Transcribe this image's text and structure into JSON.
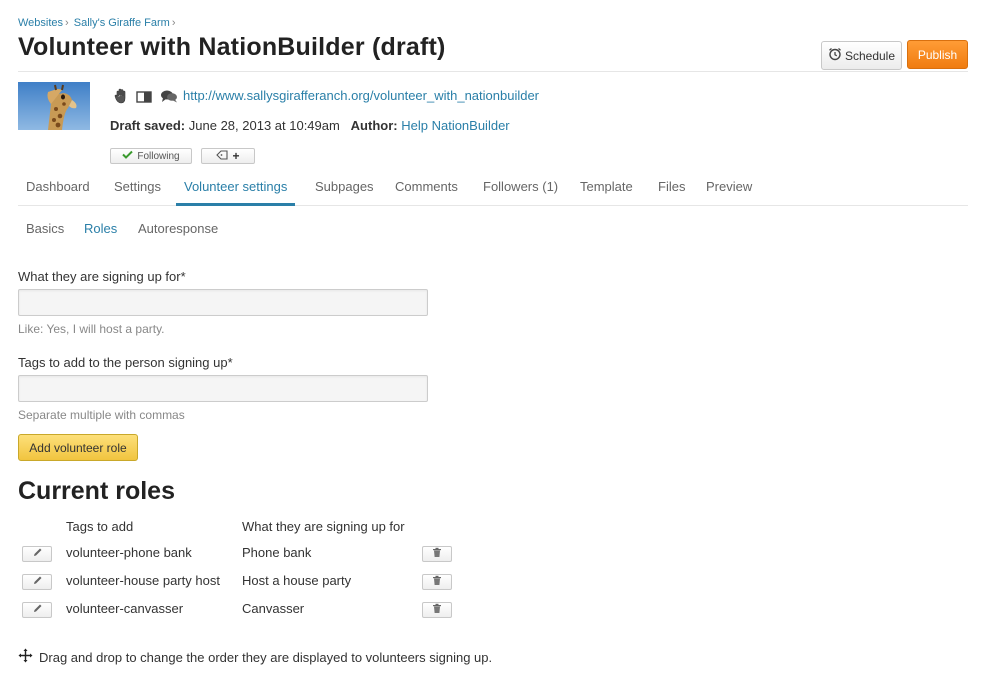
{
  "breadcrumb": {
    "items": [
      "Websites",
      "Sally's Giraffe Farm"
    ],
    "separator": "›"
  },
  "page": {
    "title": "Volunteer with NationBuilder (draft)",
    "url": "http://www.sallysgirafferanch.org/volunteer_with_nationbuilder",
    "draft_label": "Draft saved:",
    "draft_date": "June 28, 2013 at 10:49am",
    "author_label": "Author:",
    "author_name": "Help NationBuilder"
  },
  "actions": {
    "schedule_label": "Schedule",
    "publish_label": "Publish",
    "following_label": "Following",
    "tag_add_glyph": "+"
  },
  "tabs": [
    {
      "label": "Dashboard",
      "active": false
    },
    {
      "label": "Settings",
      "active": false
    },
    {
      "label": "Volunteer settings",
      "active": true
    },
    {
      "label": "Subpages",
      "active": false
    },
    {
      "label": "Comments",
      "active": false
    },
    {
      "label": "Followers (1)",
      "active": false
    },
    {
      "label": "Template",
      "active": false
    },
    {
      "label": "Files",
      "active": false
    },
    {
      "label": "Preview",
      "active": false
    }
  ],
  "subtabs": [
    {
      "label": "Basics",
      "active": false
    },
    {
      "label": "Roles",
      "active": true
    },
    {
      "label": "Autoresponse",
      "active": false
    }
  ],
  "form": {
    "signing_up_label": "What they are signing up for*",
    "signing_up_value": "",
    "signing_up_hint": "Like: Yes, I will host a party.",
    "tags_label": "Tags to add to the person signing up*",
    "tags_value": "",
    "tags_hint": "Separate multiple with commas",
    "add_button_label": "Add volunteer role"
  },
  "roles": {
    "title": "Current roles",
    "col_tags": "Tags to add",
    "col_what": "What they are signing up for",
    "rows": [
      {
        "tag": "volunteer-phone bank",
        "what": "Phone bank"
      },
      {
        "tag": "volunteer-house party host",
        "what": "Host a house party"
      },
      {
        "tag": "volunteer-canvasser",
        "what": "Canvasser"
      }
    ],
    "drag_note": "Drag and drop to change the order they are displayed to volunteers signing up."
  },
  "icons": {
    "schedule": "alarm-clock-icon",
    "following": "checkmark-icon",
    "tag": "tag-icon",
    "hand": "hand-icon",
    "layout": "layout-icon",
    "comments": "speech-bubbles-icon",
    "edit": "pencil-icon",
    "delete": "trash-icon",
    "drag": "move-arrows-icon"
  },
  "colors": {
    "link": "#2a7fa8",
    "publish": "#f7881f",
    "add_button": "#f5cf53",
    "check": "#3a9a2e"
  }
}
